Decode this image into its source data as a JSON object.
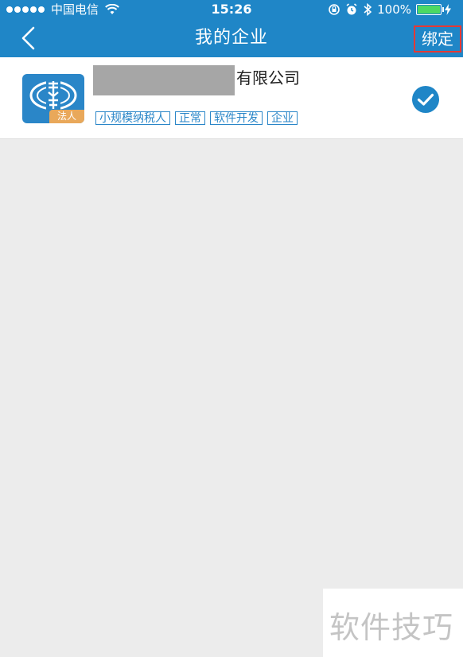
{
  "status_bar": {
    "carrier": "中国电信",
    "time": "15:26",
    "battery_percent": "100%",
    "battery_level": 1.0,
    "signal_bars": 5
  },
  "nav": {
    "title": "我的企业",
    "bind_label": "绑定",
    "back_icon": "chevron-left-icon"
  },
  "company": {
    "name_suffix": "有限公司",
    "logo_badge": "法人",
    "tags": [
      "小规模纳税人",
      "正常",
      "软件开发",
      "企业"
    ],
    "selected": true
  },
  "watermark": {
    "text": "软件技巧"
  },
  "colors": {
    "primary": "#1f86c7",
    "tag_blue": "#2a86c8",
    "badge_orange": "#e9a85a",
    "bind_border": "#e53935",
    "battery_green": "#4cd964",
    "background": "#ececec"
  }
}
